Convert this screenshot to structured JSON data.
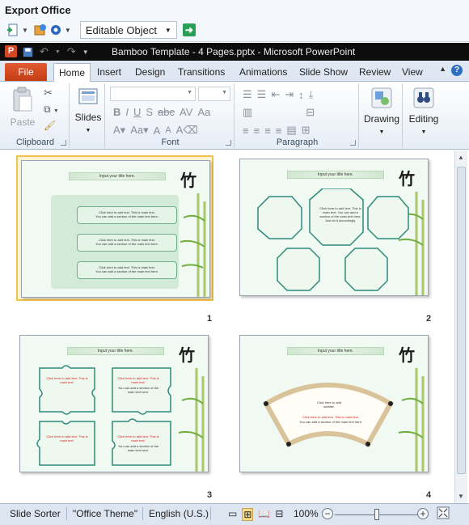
{
  "export_office": {
    "title": "Export Office",
    "mode_value": "Editable Object"
  },
  "powerpoint": {
    "window_title": "Bamboo Template - 4 Pages.pptx  -  Microsoft PowerPoint",
    "logo_letter": "P"
  },
  "ribbon": {
    "file_tab": "File",
    "tabs": [
      "Home",
      "Insert",
      "Design",
      "Transitions",
      "Animations",
      "Slide Show",
      "Review",
      "View"
    ],
    "active_tab": "Home",
    "groups": {
      "clipboard": "Clipboard",
      "font": "Font",
      "paragraph": "Paragraph"
    },
    "buttons": {
      "paste": "Paste",
      "slides": "Slides",
      "drawing": "Drawing",
      "editing": "Editing"
    }
  },
  "slides": [
    {
      "number": "1",
      "title": "Input your title here.",
      "boxes": [
        [
          "Click here to add text. This is main text.",
          "You can add a section of the main text here."
        ],
        [
          "Click here to add text. This is main text.",
          "You can add a section of the main text here."
        ],
        [
          "Click here to add text. This is main text.",
          "You can add a section of the main text here."
        ]
      ]
    },
    {
      "number": "2",
      "title": "Input your title here.",
      "frame_text": "Click here to add text. This is main text. You can add a section of the main text here. Just do it accordingly."
    },
    {
      "number": "3",
      "title": "Input your title here.",
      "puzzle_red": "Click here to add text. This is main text.",
      "puzzle_black": "You can add a section of the main text here."
    },
    {
      "number": "4",
      "title": "Input your title here.",
      "subtitle": "Click here to add subtitle.",
      "fan_red": "Click here to add text. This is main text.",
      "fan_black": "You can add a section of the main text here."
    }
  ],
  "statusbar": {
    "view": "Slide Sorter",
    "theme": "\"Office Theme\"",
    "language": "English (U.S.)",
    "zoom": "100%",
    "zoom_level_percent": 50
  },
  "colors": {
    "file_tab": "#d24726",
    "selection": "#f0c24a",
    "slide_green": "#f1f9f3"
  }
}
